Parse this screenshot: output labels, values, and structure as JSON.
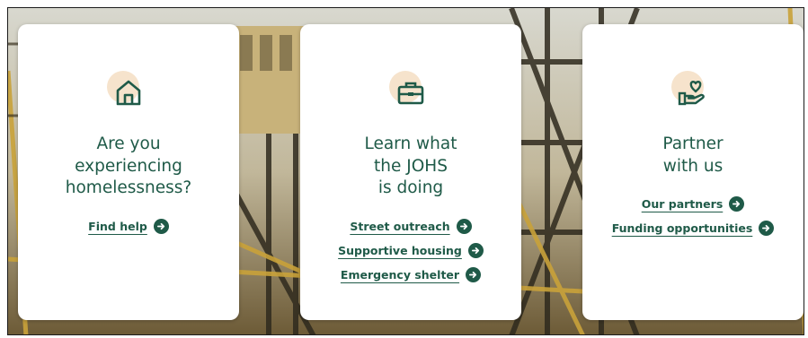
{
  "colors": {
    "accent": "#1f5a48",
    "icon_blob": "#f6e3cc",
    "card_bg": "#ffffff"
  },
  "cards": [
    {
      "icon": "home-icon",
      "title_lines": [
        "Are you",
        "experiencing",
        "homelessness?"
      ],
      "links": [
        {
          "label": "Find help",
          "icon": "arrow-right-circle-icon"
        }
      ]
    },
    {
      "icon": "toolbox-icon",
      "title_lines": [
        "Learn what",
        "the JOHS",
        "is doing"
      ],
      "links": [
        {
          "label": "Street outreach",
          "icon": "arrow-right-circle-icon"
        },
        {
          "label": "Supportive housing",
          "icon": "arrow-right-circle-icon"
        },
        {
          "label": "Emergency shelter",
          "icon": "arrow-right-circle-icon"
        }
      ]
    },
    {
      "icon": "heart-hand-icon",
      "title_lines": [
        "Partner",
        "with us"
      ],
      "links": [
        {
          "label": "Our partners",
          "icon": "arrow-right-circle-icon"
        },
        {
          "label": "Funding opportunities",
          "icon": "arrow-right-circle-icon"
        }
      ]
    }
  ]
}
